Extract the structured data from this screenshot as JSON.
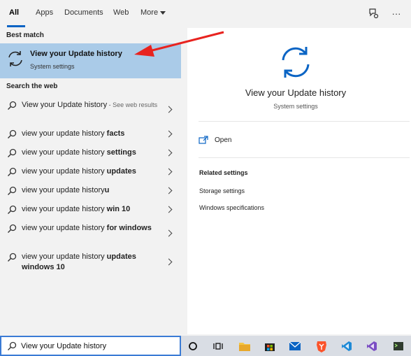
{
  "tabs": [
    {
      "label": "All"
    },
    {
      "label": "Apps"
    },
    {
      "label": "Documents"
    },
    {
      "label": "Web"
    },
    {
      "label": "More"
    }
  ],
  "toolbar": {
    "feedback_icon": "feedback-icon",
    "more_icon": "ellipsis-icon",
    "more_label": "···"
  },
  "best_match": {
    "header": "Best match",
    "title": "View your Update history",
    "subtitle": "System settings",
    "icon": "sync-icon"
  },
  "web": {
    "header": "Search the web",
    "items": [
      {
        "prefix": "View your Update history",
        "bold": "",
        "hint": " - See web results"
      },
      {
        "prefix": "view your update history ",
        "bold": "facts",
        "hint": ""
      },
      {
        "prefix": "view your update history ",
        "bold": "settings",
        "hint": ""
      },
      {
        "prefix": "view your update history ",
        "bold": "updates",
        "hint": ""
      },
      {
        "prefix": "view your update history",
        "bold": "u",
        "hint": ""
      },
      {
        "prefix": "view your update history ",
        "bold": "win 10",
        "hint": ""
      },
      {
        "prefix": "view your update history ",
        "bold": "for windows",
        "hint": ""
      },
      {
        "prefix": "view your update history ",
        "bold": "updates windows 10",
        "hint": ""
      }
    ]
  },
  "detail": {
    "title": "View your Update history",
    "subtitle": "System settings",
    "open_label": "Open",
    "related_header": "Related settings",
    "related": [
      "Storage settings",
      "Windows specifications"
    ]
  },
  "search": {
    "value": "View your Update history"
  },
  "taskbar": {
    "items": [
      "cortana-icon",
      "task-view-icon",
      "file-explorer-icon",
      "store-icon",
      "mail-icon",
      "brave-icon",
      "vscode-icon",
      "visual-studio-icon",
      "terminal-icon"
    ]
  },
  "colors": {
    "accent": "#0a64c4",
    "selection": "#aacbe8",
    "arrow": "#e8231f"
  }
}
